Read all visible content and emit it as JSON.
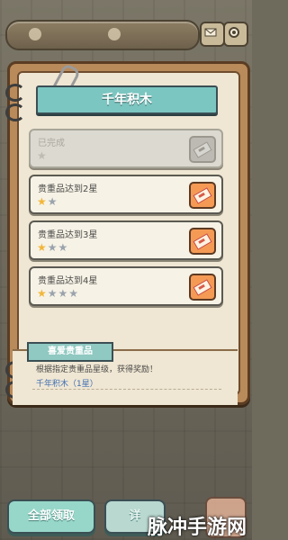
{
  "title": "千年积木",
  "quests": [
    {
      "label": "已完成",
      "stars": 1,
      "max_stars": 1,
      "state": "done"
    },
    {
      "label": "贵重品达到2星",
      "stars": 1,
      "max_stars": 2,
      "state": "active"
    },
    {
      "label": "贵重品达到3星",
      "stars": 1,
      "max_stars": 3,
      "state": "active"
    },
    {
      "label": "贵重品达到4星",
      "stars": 1,
      "max_stars": 4,
      "state": "active"
    }
  ],
  "info": {
    "tag": "喜爱贵重品",
    "description": "根据指定贵重品星级，获得奖励！",
    "item": "千年积木（1星）"
  },
  "buttons": {
    "claim_all": "全部领取",
    "detail": "详"
  },
  "watermark": "脉冲手游网",
  "colors": {
    "accent": "#7cc6c1",
    "star_full": "#f2b63a",
    "star_empty": "#9aa3ad",
    "ticket": "#f49a55"
  },
  "icons": [
    "mail-icon",
    "gear-icon",
    "ticket-icon",
    "star-icon",
    "paperclip-icon"
  ]
}
